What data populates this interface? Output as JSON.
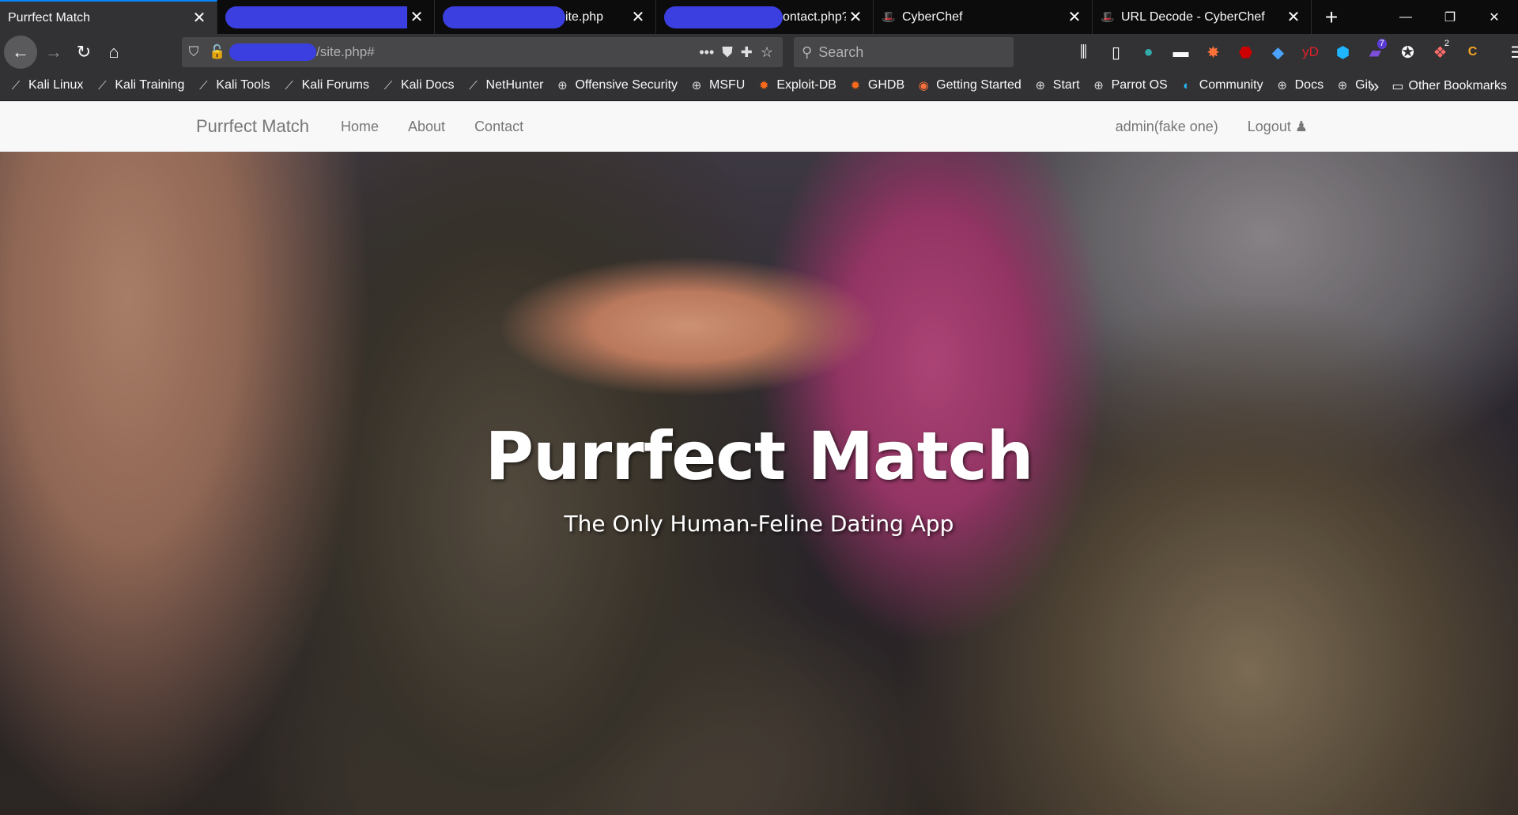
{
  "browser": {
    "tabs": [
      {
        "title": "Purrfect Match",
        "active": true,
        "redacted": false
      },
      {
        "title": "",
        "active": false,
        "redacted": true
      },
      {
        "title": "ite.php",
        "active": false,
        "redacted": true
      },
      {
        "title": "ontact.php?c",
        "active": false,
        "redacted": true
      },
      {
        "title": "CyberChef",
        "active": false,
        "redacted": false
      },
      {
        "title": "URL Decode - CyberChef",
        "active": false,
        "redacted": false
      }
    ],
    "new_tab": "+",
    "window_controls": {
      "minimize": "—",
      "restore": "❐",
      "close": "✕"
    },
    "url": "/site.php#",
    "search_placeholder": "Search",
    "toolbar_badges": {
      "container": "7",
      "notifications": "2"
    },
    "toolbar_ext_labels": {
      "yandex": "yD",
      "coin": "C"
    }
  },
  "bookmarks": [
    {
      "label": "Kali Linux",
      "icon": "kali-dragon-icon"
    },
    {
      "label": "Kali Training",
      "icon": "kali-dragon-icon"
    },
    {
      "label": "Kali Tools",
      "icon": "kali-dragon-icon"
    },
    {
      "label": "Kali Forums",
      "icon": "kali-dragon-icon"
    },
    {
      "label": "Kali Docs",
      "icon": "kali-dragon-icon"
    },
    {
      "label": "NetHunter",
      "icon": "kali-dragon-icon"
    },
    {
      "label": "Offensive Security",
      "icon": "globe-icon"
    },
    {
      "label": "MSFU",
      "icon": "globe-icon"
    },
    {
      "label": "Exploit-DB",
      "icon": "exploitdb-icon"
    },
    {
      "label": "GHDB",
      "icon": "exploitdb-icon"
    },
    {
      "label": "Getting Started",
      "icon": "firefox-icon"
    },
    {
      "label": "Start",
      "icon": "globe-icon"
    },
    {
      "label": "Parrot OS",
      "icon": "globe-icon"
    },
    {
      "label": "Community",
      "icon": "parrot-icon"
    },
    {
      "label": "Docs",
      "icon": "globe-icon"
    },
    {
      "label": "Git",
      "icon": "globe-icon"
    }
  ],
  "bookmarks_overflow": "»",
  "other_bookmarks": "Other Bookmarks",
  "site": {
    "brand": "Purrfect Match",
    "nav": {
      "home": "Home",
      "about": "About",
      "contact": "Contact"
    },
    "user": "admin(fake one)",
    "logout": "Logout",
    "heading": "Purrfect Match",
    "subheading": "The Only Human-Feline Dating App"
  },
  "colors": {
    "accent_tab": "#0a84ff",
    "redaction": "#3b3fe0",
    "navbar_bg": "#f8f8f8",
    "nav_text": "#777777"
  }
}
